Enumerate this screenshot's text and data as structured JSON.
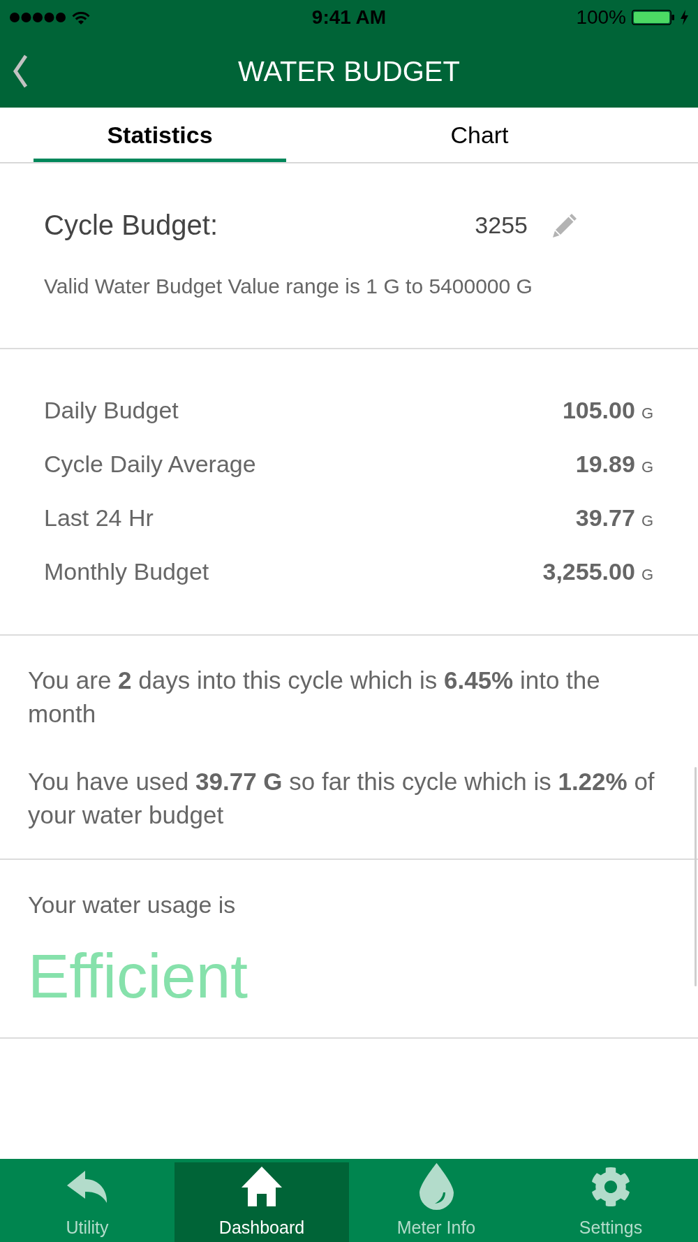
{
  "status_bar": {
    "time": "9:41 AM",
    "battery": "100%"
  },
  "header": {
    "title": "WATER BUDGET"
  },
  "tabs": [
    {
      "label": "Statistics",
      "selected": true
    },
    {
      "label": "Chart",
      "selected": false
    }
  ],
  "cycle_budget": {
    "label": "Cycle Budget:",
    "value": "3255",
    "hint": "Valid Water Budget Value range is 1 G to 5400000 G"
  },
  "stats": [
    {
      "label": "Daily Budget",
      "value": "105.00",
      "unit": "G"
    },
    {
      "label": "Cycle Daily Average",
      "value": "19.89",
      "unit": "G"
    },
    {
      "label": "Last 24 Hr",
      "value": "39.77",
      "unit": "G"
    },
    {
      "label": "Monthly Budget",
      "value": "3,255.00",
      "unit": "G"
    }
  ],
  "summary": [
    "You are **2** days into this cycle which is **6.45%** into the month",
    "You have used **39.77 G** so far this cycle which is **1.22%** of your water budget"
  ],
  "usage": {
    "label": "Your water usage is",
    "rating": "Efficient"
  },
  "bottom_tabs": [
    {
      "label": "Utility",
      "selected": false
    },
    {
      "label": "Dashboard",
      "selected": true
    },
    {
      "label": "Meter Info",
      "selected": false
    },
    {
      "label": "Settings",
      "selected": false
    }
  ]
}
